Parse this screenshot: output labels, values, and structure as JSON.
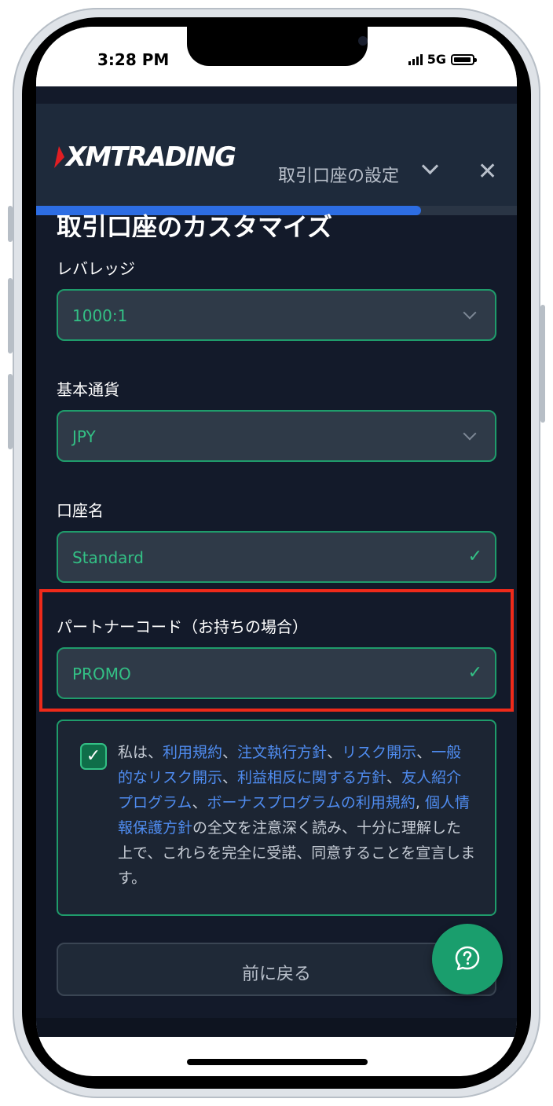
{
  "status_bar": {
    "time": "3:28 PM",
    "network": "5G"
  },
  "header": {
    "logo": "XMTRADING",
    "title": "取引口座の設定",
    "progress_fraction": 0.8
  },
  "page": {
    "title": "取引口座のカスタマイズ"
  },
  "fields": {
    "leverage": {
      "label": "レバレッジ",
      "value": "1000:1"
    },
    "currency": {
      "label": "基本通貨",
      "value": "JPY"
    },
    "account_name": {
      "label": "口座名",
      "value": "Standard"
    },
    "partner_code": {
      "label": "パートナーコード（お持ちの場合）",
      "value": "PROMO"
    }
  },
  "consent": {
    "checked": true,
    "prefix": "私は、",
    "links": [
      "利用規約",
      "注文執行方針",
      "リスク開示",
      "一般的なリスク開示",
      "利益相反に関する方針",
      "友人紹介プログラム",
      "ボーナスプログラムの利用規約",
      "個人情報保護方針"
    ],
    "separators": [
      "、",
      "、",
      "、",
      "、",
      "、",
      "、",
      ", "
    ],
    "suffix": "の全文を注意深く読み、十分に理解した上で、これらを完全に受諾、同意することを宣言します。"
  },
  "buttons": {
    "back": "前に戻る"
  },
  "colors": {
    "accent_green": "#33c085",
    "highlight_red": "#ee2a1a",
    "link_blue": "#4f8cf0",
    "brand_red": "#e01e23"
  }
}
